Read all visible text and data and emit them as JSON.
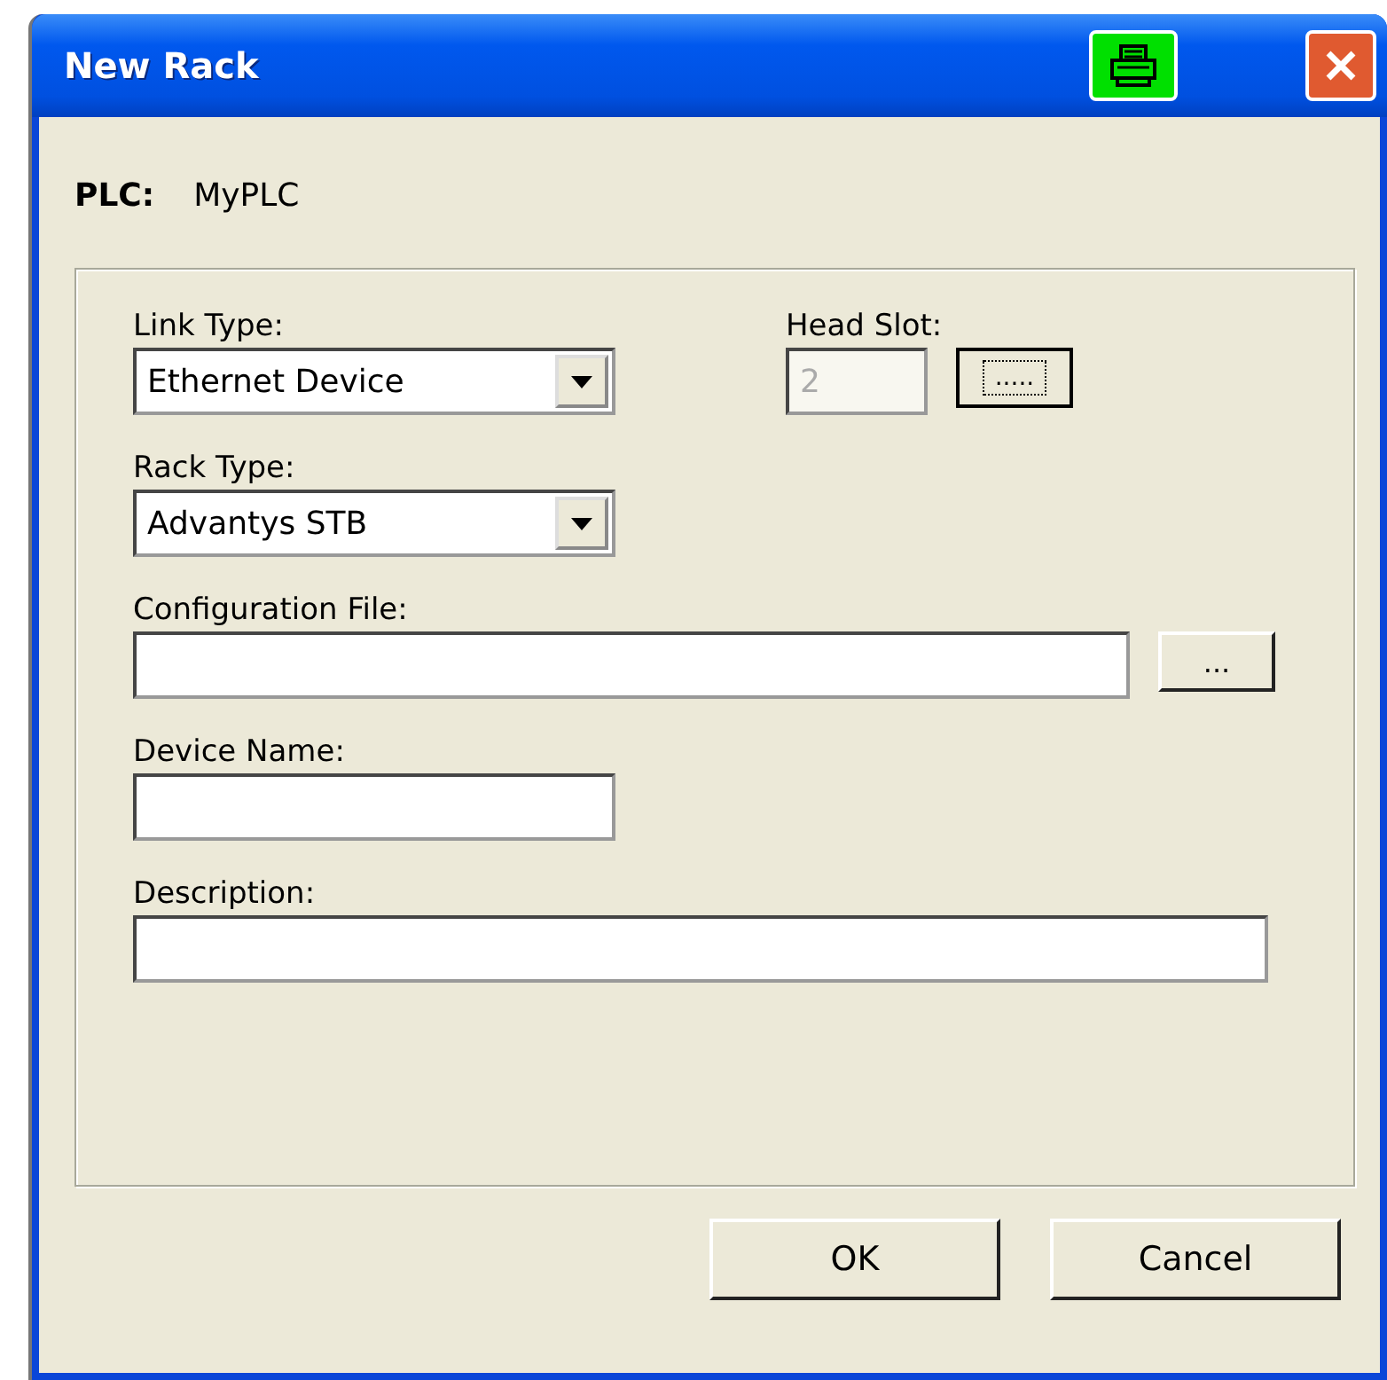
{
  "window": {
    "title": "New Rack"
  },
  "plc": {
    "label": "PLC:",
    "value": "MyPLC"
  },
  "link_type": {
    "label": "Link Type:",
    "value": "Ethernet Device"
  },
  "head_slot": {
    "label": "Head Slot:",
    "value": "2",
    "disabled": true,
    "button": "....."
  },
  "rack_type": {
    "label": "Rack Type:",
    "value": "Advantys STB"
  },
  "configuration_file": {
    "label": "Configuration File:",
    "button": "..."
  },
  "device_name": {
    "label": "Device Name:"
  },
  "description": {
    "label": "Description:"
  },
  "buttons": [
    "OK",
    "Cancel"
  ]
}
